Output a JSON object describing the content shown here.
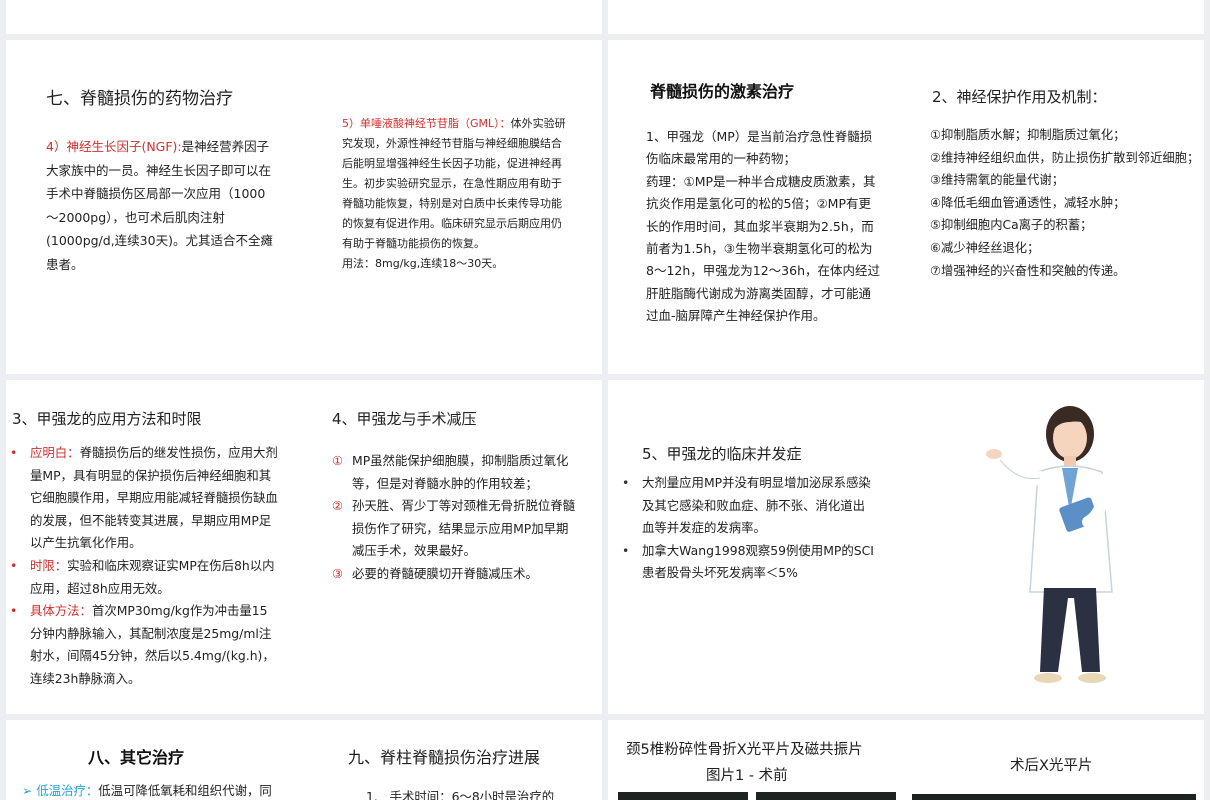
{
  "s1": {
    "title": "七、脊髓损伤的药物治疗",
    "ngf_label": "4）神经生长因子(NGF):",
    "ngf_text": "是神经营养因子大家族中的一员。神经生长因子即可以在手术中脊髓损伤区局部一次应用（1000～2000pg），也可术后肌肉注射(1000pg/d,连续30天)。尤其适合不全瘫患者。",
    "gml_label": "5）单唾液酸神经节苷脂（GML）：",
    "gml_text": "体外实验研究发现，外源性神经节苷脂与神经细胞膜结合后能明显增强神经生长因子功能，促进神经再生。初步实验研究显示，在急性期应用有助于脊髓功能恢复，特别是对白质中长束传导功能的恢复有促进作用。临床研究显示后期应用仍有助于脊髓功能损伤的恢复。",
    "gml_usage": "用法：8mg/kg,连续18～30天。"
  },
  "s2": {
    "title": "脊髓损伤的激素治疗",
    "lines": [
      "1、甲强龙（MP）是当前治疗急性脊髓损",
      "伤临床最常用的一种药物；",
      "药理：①MP是一种半合成糖皮质激素，其",
      "抗炎作用是氢化可的松的5倍；②MP有更",
      "长的作用时间，其血浆半衰期为2.5h，而",
      "前者为1.5h，③生物半衰期氢化可的松为",
      "8～12h，甲强龙为12～36h，在体内经过",
      "肝脏脂酶代谢成为游离类固醇，才可能通",
      "过血-脑屏障产生神经保护作用。"
    ],
    "right_title": "2、神经保护作用及机制：",
    "right_items": [
      "①抑制脂质水解；抑制脂质过氧化；",
      "②维持神经组织血供，防止损伤扩散到邻近细胞；",
      "③维持需氧的能量代谢；",
      "④降低毛细血管通透性，减轻水肿；",
      "⑤抑制细胞内Ca离子的积蓄；",
      "⑥减少神经丝退化；",
      "⑦增强神经的兴奋性和突触的传递。"
    ]
  },
  "s3": {
    "title": "3、甲强龙的应用方法和时限",
    "items": [
      {
        "bullet": "•",
        "label": "应明白：",
        "text": "脊髓损伤后的继发性损伤，应用大剂量MP，具有明显的保护损伤后神经细胞和其它细胞膜作用，早期应用能减轻脊髓损伤缺血的发展，但不能转变其进展，早期应用MP足以产生抗氧化作用。"
      },
      {
        "bullet": "•",
        "label": "时限：",
        "text": "实验和临床观察证实MP在伤后8h以内应用，超过8h应用无效。"
      },
      {
        "bullet": "•",
        "label": "具体方法：",
        "text": "首次MP30mg/kg作为冲击量15分钟内静脉输入，其配制浓度是25mg/ml注射水，间隔45分钟，然后以5.4mg/(kg.h)，连续23h静脉滴入。"
      }
    ],
    "mid_title": "4、甲强龙与手术减压",
    "mid_items": [
      {
        "bullet": "①",
        "text": "MP虽然能保护细胞膜，抑制脂质过氧化等，但是对脊髓水肿的作用较差；"
      },
      {
        "bullet": "②",
        "text": "孙天胜、胥少丁等对颈椎无骨折脱位脊髓损伤作了研究，结果显示应用MP加早期减压手术，效果最好。"
      },
      {
        "bullet": "③",
        "text": "必要的脊髓硬膜切开脊髓减压术。"
      }
    ]
  },
  "s4": {
    "title": "5、甲强龙的临床并发症",
    "items": [
      {
        "bullet": "•",
        "text": "大剂量应用MP并没有明显增加泌尿系感染及其它感染和败血症、肺不张、消化道出血等并发症的发病率。"
      },
      {
        "bullet": "•",
        "text": "加拿大Wang1998观察59例使用MP的SCI患者股骨头坏死发病率＜5%"
      }
    ],
    "figure_icon": "doctor-illustration-icon"
  },
  "s5": {
    "title": "八、其它治疗",
    "first_label": "低温治疗：",
    "first_text": "低温可降低氧耗和组织代谢，同",
    "arrow_icon": "arrow-bullet-icon",
    "mid_title": "九、脊柱脊髓损伤治疗进展",
    "mid_first": "1.   手术时间：6～8小时是治疗的"
  },
  "s6": {
    "title1": "颈5椎粉碎性骨折X光平片及磁共振片",
    "title2": "图片1 - 术前",
    "title3": "术后X光平片"
  }
}
